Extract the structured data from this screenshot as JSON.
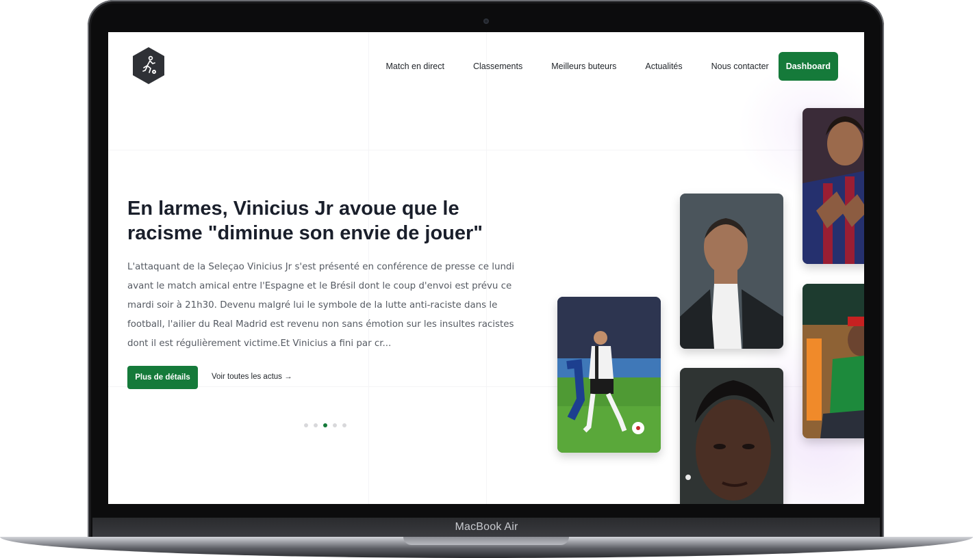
{
  "device": {
    "label": "MacBook Air"
  },
  "site": {
    "logo_icon": "soccer-player-icon",
    "nav": {
      "items": [
        "Match en direct",
        "Classements",
        "Meilleurs buteurs",
        "Actualités",
        "Nous contacter"
      ],
      "dashboard_label": "Dashboard"
    }
  },
  "hero": {
    "headline": "En larmes, Vinicius Jr avoue que le racisme \"diminue son envie de jouer\"",
    "excerpt": "L'attaquant de la Seleçao Vinicius Jr s'est présenté en conférence de presse ce lundi avant le match amical entre l'Espagne et le Brésil dont le coup d'envoi est prévu ce mardi soir à 21h30. Devenu malgré lui le symbole de la lutte anti-raciste dans le football, l'ailier du Real Madrid est revenu non sans émotion sur les insultes racistes dont il est régulièrement victime.Et Vinicius a fini par cr...",
    "details_button": "Plus de détails",
    "all_news_link": "Voir toutes les actus →",
    "carousel": {
      "slides": 5,
      "active_index": 2
    }
  },
  "colors": {
    "accent": "#157a3a",
    "heading": "#1a1f2b",
    "body_text": "#555a62"
  }
}
